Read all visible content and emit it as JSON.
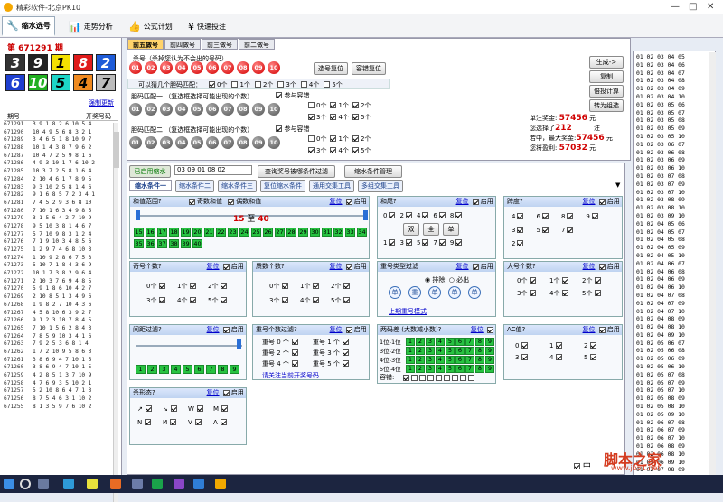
{
  "window": {
    "title": "精彩软件-北京PK10",
    "controls": [
      "—",
      "□",
      "✕"
    ]
  },
  "toolbar": {
    "items": [
      {
        "label": "缩水选号",
        "icon": "wrench-icon"
      },
      {
        "label": "走势分析",
        "icon": "chart-icon"
      },
      {
        "label": "公式计划",
        "icon": "thumb-icon"
      },
      {
        "label": "快速投注",
        "icon": "yen-icon"
      }
    ]
  },
  "left": {
    "issue": "第 671291 期",
    "digits": [
      {
        "v": "3",
        "bg": "#333",
        "fg": "#fff"
      },
      {
        "v": "9",
        "bg": "#222",
        "fg": "#fff"
      },
      {
        "v": "1",
        "bg": "#f4e000",
        "fg": "#000"
      },
      {
        "v": "8",
        "bg": "#e01b1b",
        "fg": "#fff"
      },
      {
        "v": "2",
        "bg": "#1e5bd8",
        "fg": "#fff"
      },
      {
        "v": "6",
        "bg": "#1e3fd0",
        "fg": "#fff"
      },
      {
        "v": "10",
        "bg": "#20b020",
        "fg": "#fff"
      },
      {
        "v": "5",
        "bg": "#1dd6c8",
        "fg": "#000"
      },
      {
        "v": "4",
        "bg": "#f08a20",
        "fg": "#000"
      },
      {
        "v": "7",
        "bg": "#bbb",
        "fg": "#000"
      }
    ],
    "refresh": "强制更新",
    "hist_hdr": {
      "period": "期号",
      "numbers": "开奖号码"
    },
    "history": [
      [
        "671291",
        "3 9 1 8 2 6 10 5 4"
      ],
      [
        "671290",
        "10 4 9 5 6 8 3 2 1"
      ],
      [
        "671289",
        "3 4 6 5 1 8 10 9 7"
      ],
      [
        "671288",
        "10 1 4 3 8 7 9 6 2"
      ],
      [
        "671287",
        "10 4 7 2 5 9 8 1 6"
      ],
      [
        "671286",
        "4 9 3 10 1 7 6 10 2"
      ],
      [
        "671285",
        "10 3 7 2 5 8 1 6 4"
      ],
      [
        "671284",
        "2 10 4 6 1 7 8 9 5"
      ],
      [
        "671283",
        "9 3 10 2 5 8 1 4 6"
      ],
      [
        "671282",
        "9 1 6 8 5 7 2 3 4 1"
      ],
      [
        "671281",
        "7 4 5 2 9 3 6 8 10"
      ],
      [
        "671280",
        "7 10 1 6 3 4 9 8 5"
      ],
      [
        "671279",
        "3 1 5 6 4 2 7 10 9"
      ],
      [
        "671278",
        "9 5 10 3 8 1 4 6 7"
      ],
      [
        "671277",
        "5 7 10 9 8 3 1 2 4"
      ],
      [
        "671276",
        "7 1 9 10 3 4 8 5 6"
      ],
      [
        "671275",
        "1 2 9 7 4 6 8 10 3"
      ],
      [
        "671274",
        "1 10 9 2 8 6 7 5 3"
      ],
      [
        "671273",
        "5 10 7 1 8 4 3 6 9"
      ],
      [
        "671272",
        "10 1 7 3 8 2 9 6 4"
      ],
      [
        "671271",
        "2 10 3 7 6 9 4 8 5"
      ],
      [
        "671270",
        "5 9 1 8 6 10 4 2 7"
      ],
      [
        "671269",
        "2 10 8 5 1 3 4 9 6"
      ],
      [
        "671268",
        "1 9 8 2 7 10 4 3 6"
      ],
      [
        "671267",
        "4 5 8 10 6 3 9 2 7"
      ],
      [
        "671266",
        "9 1 2 3 10 7 8 4 5"
      ],
      [
        "671265",
        "7 10 1 5 6 2 8 4 3"
      ],
      [
        "671264",
        "7 8 5 9 10 3 4 1 6"
      ],
      [
        "671263",
        "7 9 2 5 3 6 8 1 4"
      ],
      [
        "671262",
        "1 7 2 10 9 5 8 6 3"
      ],
      [
        "671261",
        "3 8 6 9 4 7 10 1 5"
      ],
      [
        "671260",
        "3 8 6 9 4 7 10 1 5"
      ],
      [
        "671259",
        "4 2 8 5 1 3 7 10 9"
      ],
      [
        "671258",
        "4 7 6 9 3 5 10 2 1"
      ],
      [
        "671257",
        "5 2 10 8 6 4 7 1 3"
      ],
      [
        "671256",
        "8 7 5 4 6 3 1 10 2"
      ],
      [
        "671255",
        "8 1 3 5 9 7 6 10 2"
      ]
    ]
  },
  "top": {
    "tabs": [
      "前五做号",
      "前四做号",
      "前三做号",
      "前二做号"
    ],
    "kill_label": "杀号（杀掉您认为不会出的号码）",
    "balls": [
      "01",
      "02",
      "03",
      "04",
      "05",
      "06",
      "07",
      "08",
      "09",
      "10"
    ],
    "btn_reset": "选号复位",
    "btn_fault": "容错复位",
    "kill_opts_label": "可以猜几个胆码匹配：",
    "kill_opts": [
      "0个",
      "1个",
      "2个",
      "3个",
      "4个",
      "5个"
    ],
    "group1": "胆码匹配一 （复选框选择可能出现的个数）",
    "group2": "胆码匹配二 （复选框选择可能出现的个数）",
    "join": "参与容错",
    "g1opts": [
      "0个",
      "1个",
      "2个",
      "3个",
      "4个",
      "5个"
    ],
    "g2opts": [
      "0个",
      "1个",
      "2个",
      "3个",
      "4个",
      "5个"
    ]
  },
  "side": {
    "btn_generate": "生成->",
    "btn_copy": "复制",
    "btn_multi": "倍投计算",
    "btn_group": "转为组选",
    "single_prize_label": "单注奖金:",
    "single_prize": "57456",
    "yuan": "元",
    "chosen_label": "您选择了",
    "chosen": "212",
    "zhu": "注",
    "max_label": "若中，最大奖金:",
    "max": "57456",
    "profit_label": "您将盈利:",
    "profit": "57032"
  },
  "numlist": [
    "01 02 03 04 05",
    "01 02 03 04 06",
    "01 02 03 04 07",
    "01 02 03 04 08",
    "01 02 03 04 09",
    "01 02 03 04 10",
    "01 02 03 05 06",
    "01 02 03 05 07",
    "01 02 03 05 08",
    "01 02 03 05 09",
    "01 02 03 05 10",
    "01 02 03 06 07",
    "01 02 03 06 08",
    "01 02 03 06 09",
    "01 02 03 06 10",
    "01 02 03 07 08",
    "01 02 03 07 09",
    "01 02 03 07 10",
    "01 02 03 08 09",
    "01 02 03 08 10",
    "01 02 03 09 10",
    "01 02 04 05 06",
    "01 02 04 05 07",
    "01 02 04 05 08",
    "01 02 04 05 09",
    "01 02 04 05 10",
    "01 02 04 06 07",
    "01 02 04 06 08",
    "01 02 04 06 09",
    "01 02 04 06 10",
    "01 02 04 07 08",
    "01 02 04 07 09",
    "01 02 04 07 10",
    "01 02 04 08 09",
    "01 02 04 08 10",
    "01 02 04 09 10",
    "01 02 05 06 07",
    "01 02 05 06 08",
    "01 02 05 06 09",
    "01 02 05 06 10",
    "01 02 05 07 08",
    "01 02 05 07 09",
    "01 02 05 07 10",
    "01 02 05 08 09",
    "01 02 05 08 10",
    "01 02 05 09 10",
    "01 02 06 07 08",
    "01 02 06 07 09",
    "01 02 06 07 10",
    "01 02 06 08 09",
    "01 02 06 08 10",
    "01 02 06 09 10",
    "01 02 07 08 09",
    "01 02 07 08 10",
    "01 02 07 09 10"
  ],
  "main": {
    "enabled_label": "已启用缩水",
    "enabled_value": "03 09 01 08 02",
    "btn_query": "查询奖号被哪条件过滤",
    "btn_manage": "缩水条件管理",
    "subtabs": [
      "缩水条件一",
      "缩水条件二",
      "缩水条件三",
      "复位缩水条件",
      "通用交集工具",
      "多组交集工具"
    ],
    "reset": "复位",
    "enable": "启用",
    "p_sum": {
      "title": "和值范围?",
      "odd": "奇数和值",
      "even": "偶数和值",
      "from": "15",
      "to_word": "至",
      "to": "40",
      "nums": [
        "15",
        "16",
        "17",
        "18",
        "19",
        "20",
        "21",
        "22",
        "23",
        "24",
        "25",
        "26",
        "27",
        "28",
        "29",
        "30",
        "31",
        "32",
        "33",
        "34",
        "35",
        "36",
        "37",
        "38",
        "39",
        "40"
      ]
    },
    "p_tail": {
      "title": "和尾?",
      "row1": [
        "0",
        "2",
        "4",
        "6",
        "8"
      ],
      "row2": [
        "1",
        "3",
        "5",
        "7",
        "9"
      ],
      "b1": "双",
      "b2": "全",
      "b3": "单"
    },
    "p_span": {
      "title": "跨度?",
      "row1": [
        "4",
        "6",
        "8",
        "9"
      ],
      "row2": [
        "3",
        "5",
        "7"
      ],
      "row3": [
        "2"
      ]
    },
    "p_odd": {
      "title": "奇号个数?",
      "items": [
        "0个",
        "1个",
        "2个",
        "3个",
        "4个",
        "5个"
      ]
    },
    "p_prime": {
      "title": "质数个数?",
      "items": [
        "0个",
        "1个",
        "2个",
        "3个",
        "4个",
        "5个"
      ]
    },
    "p_repeat": {
      "title": "重号类型过滤",
      "exclude": "排除",
      "must": "必出",
      "types": [
        "单",
        "重",
        "单",
        "单",
        "单"
      ],
      "link": "上期重号模式"
    },
    "p_big": {
      "title": "大号个数?",
      "items": [
        "0个",
        "1个",
        "2个",
        "3个",
        "4个",
        "5个"
      ]
    },
    "p_gap": {
      "title": "间距过滤?",
      "nums": [
        "1",
        "2",
        "3",
        "4",
        "5",
        "6",
        "7",
        "8",
        "9"
      ]
    },
    "p_rep_count": {
      "title": "重号个数过滤?",
      "items": [
        "重号 0 个",
        "重号 1 个",
        "重号 2 个",
        "重号 3 个",
        "重号 4 个",
        "重号 5 个"
      ],
      "link": "请关注当前开奖号码"
    },
    "p_diff": {
      "title": "两码差 (大数减小数)?",
      "rows": [
        "1位-1位",
        "3位-2位",
        "4位-3位",
        "5位-4位"
      ],
      "tol": "容错:",
      "nums": [
        "1",
        "2",
        "3",
        "4",
        "5",
        "6",
        "7",
        "8",
        "9"
      ]
    },
    "p_ac": {
      "title": "AC值?",
      "items": [
        "0",
        "1",
        "2",
        "3",
        "4",
        "5"
      ]
    },
    "p_shape": {
      "title": "杀形态?",
      "items": [
        "↗",
        "↘",
        "W",
        "M",
        "N",
        "И",
        "V",
        "Λ"
      ]
    }
  },
  "status": {
    "text": "中"
  },
  "watermark": {
    "cn": "脚本之家",
    "url": "www.jb51.net"
  }
}
